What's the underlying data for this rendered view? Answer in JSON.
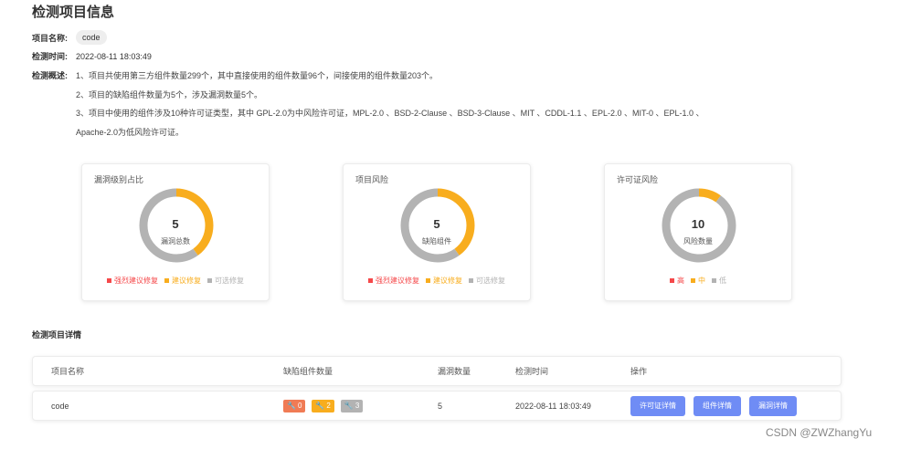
{
  "page": {
    "title": "检测项目信息"
  },
  "info": {
    "name_label": "项目名称:",
    "name_value": "code",
    "time_label": "检测时间:",
    "time_value": "2022-08-11 18:03:49",
    "summary_label": "检测概述:",
    "summary_lines": [
      "1、项目共使用第三方组件数量299个，其中直接使用的组件数量96个，间接使用的组件数量203个。",
      "2、项目的缺陷组件数量为5个，涉及漏洞数量5个。",
      "3、项目中使用的组件涉及10种许可证类型，其中 GPL-2.0为中风险许可证，MPL-2.0 、BSD-2-Clause 、BSD-3-Clause 、MIT 、CDDL-1.1 、EPL-2.0 、MIT-0 、EPL-1.0 、",
      "Apache-2.0为低风险许可证。"
    ]
  },
  "cards": [
    {
      "title": "漏洞级别占比",
      "center_value": "5",
      "center_label": "漏洞总数",
      "segments": [
        {
          "label": "强烈建议修复",
          "value": 0,
          "color": "#f5484a"
        },
        {
          "label": "建议修复",
          "value": 2,
          "color": "#f8ad1e"
        },
        {
          "label": "可选修复",
          "value": 3,
          "color": "#b3b3b3"
        }
      ]
    },
    {
      "title": "项目风险",
      "center_value": "5",
      "center_label": "缺陷组件",
      "segments": [
        {
          "label": "强烈建议修复",
          "value": 0,
          "color": "#f5484a"
        },
        {
          "label": "建议修复",
          "value": 2,
          "color": "#f8ad1e"
        },
        {
          "label": "可选修复",
          "value": 3,
          "color": "#b3b3b3"
        }
      ]
    },
    {
      "title": "许可证风险",
      "center_value": "10",
      "center_label": "风险数量",
      "segments": [
        {
          "label": "高",
          "value": 0,
          "color": "#f5484a"
        },
        {
          "label": "中",
          "value": 1,
          "color": "#f8ad1e"
        },
        {
          "label": "低",
          "value": 9,
          "color": "#b3b3b3"
        }
      ]
    }
  ],
  "details": {
    "title": "检测项目详情",
    "headers": [
      "项目名称",
      "缺陷组件数量",
      "漏洞数量",
      "检测时间",
      "操作"
    ],
    "row": {
      "name": "code",
      "badges": [
        {
          "value": "0",
          "color": "#f07b55"
        },
        {
          "value": "2",
          "color": "#f8ad1e"
        },
        {
          "value": "3",
          "color": "#b3b3b3"
        }
      ],
      "vuln_count": "5",
      "time": "2022-08-11 18:03:49",
      "actions": [
        "许可证详情",
        "组件详情",
        "漏洞详情"
      ]
    }
  },
  "watermark": "CSDN @ZWZhangYu"
}
